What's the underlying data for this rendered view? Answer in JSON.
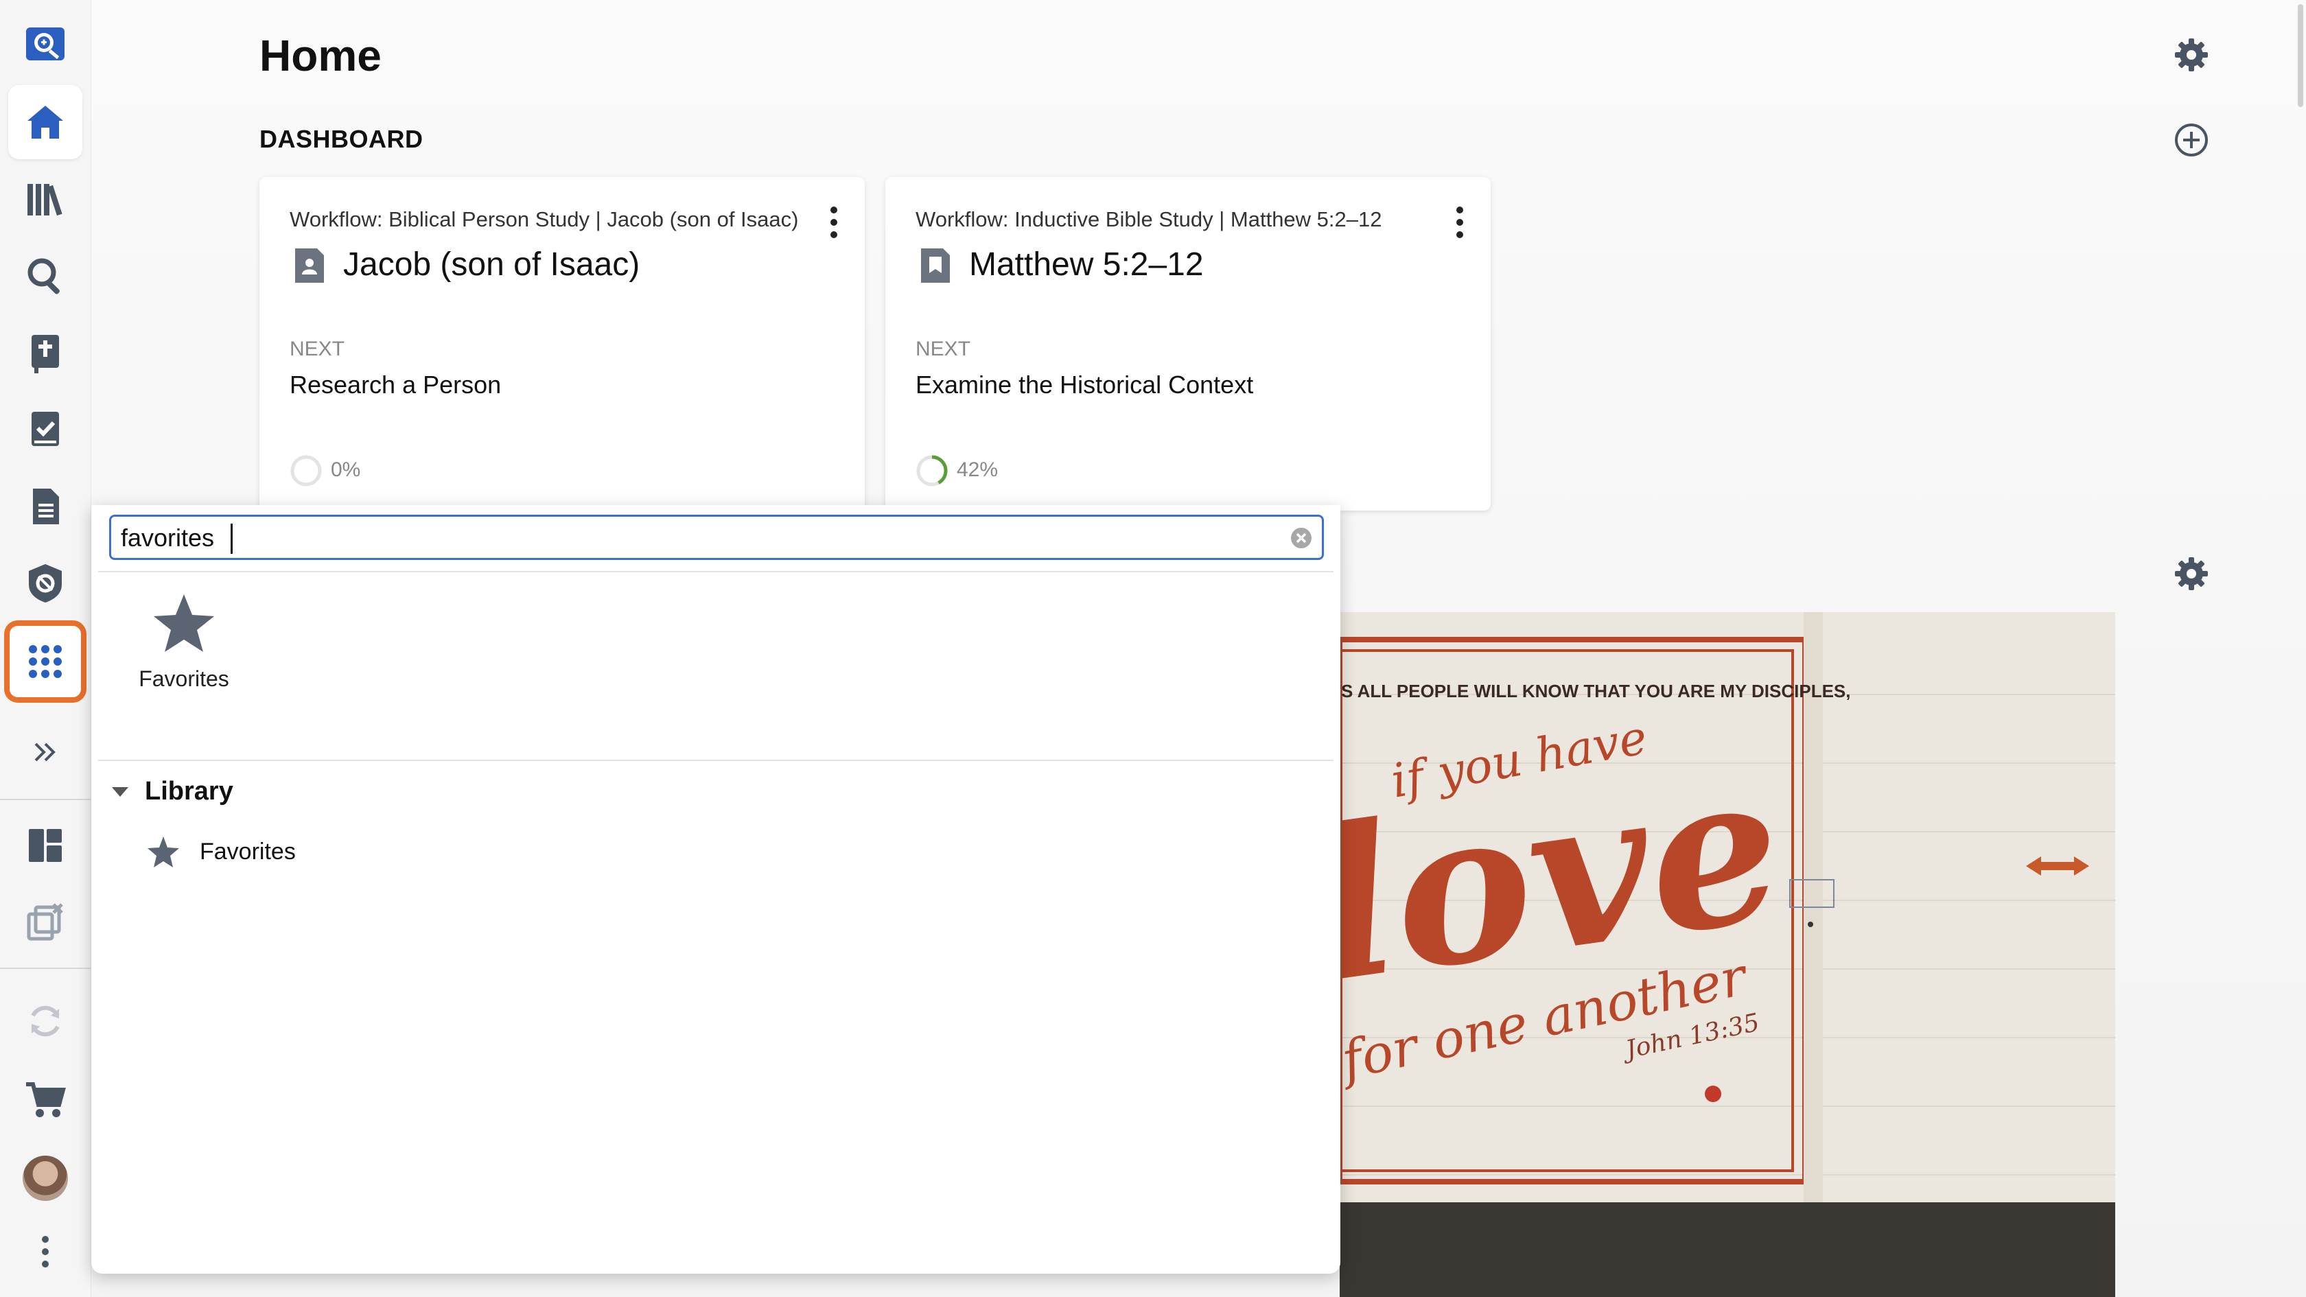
{
  "sidebar": {
    "items": [
      {
        "name": "search-library-icon"
      },
      {
        "name": "home-icon"
      },
      {
        "name": "library-icon"
      },
      {
        "name": "search-icon"
      },
      {
        "name": "bible-icon"
      },
      {
        "name": "workflows-icon"
      },
      {
        "name": "documents-icon"
      },
      {
        "name": "guides-icon"
      },
      {
        "name": "tools-grid-icon"
      },
      {
        "name": "expand-icon"
      },
      {
        "name": "layouts-icon"
      },
      {
        "name": "close-panels-icon"
      },
      {
        "name": "sync-icon"
      },
      {
        "name": "cart-icon"
      },
      {
        "name": "more-icon"
      }
    ]
  },
  "header": {
    "title": "Home"
  },
  "dashboard": {
    "section_title": "DASHBOARD",
    "cards": [
      {
        "workflow": "Workflow: Biblical Person Study | Jacob (son of Isaac)",
        "name": "Jacob (son of Isaac)",
        "next_label": "NEXT",
        "next_step": "Research a Person",
        "progress": "0%",
        "progress_value": 0
      },
      {
        "workflow": "Workflow: Inductive Bible Study | Matthew 5:2–12",
        "name": "Matthew 5:2–12",
        "next_label": "NEXT",
        "next_step": "Examine the Historical Context",
        "progress": "42%",
        "progress_value": 0.42
      }
    ]
  },
  "image_card": {
    "mural_top": "S ALL PEOPLE WILL KNOW THAT YOU ARE MY DISCIPLES,",
    "mural_line1": "if you have",
    "mural_big": "love",
    "mural_line3": "for one another",
    "mural_ref": "John 13:35"
  },
  "popup": {
    "search_value": "favorites",
    "top_result": {
      "label": "Favorites",
      "icon": "star-icon"
    },
    "group": {
      "title": "Library",
      "items": [
        {
          "label": "Favorites",
          "icon": "star-icon"
        }
      ]
    }
  },
  "colors": {
    "accent_blue": "#2b5fbf",
    "highlight_orange": "#e8702a",
    "icon_gray": "#4a5563",
    "progress_green": "#5a9e3a",
    "mural_red": "#b8472a"
  }
}
